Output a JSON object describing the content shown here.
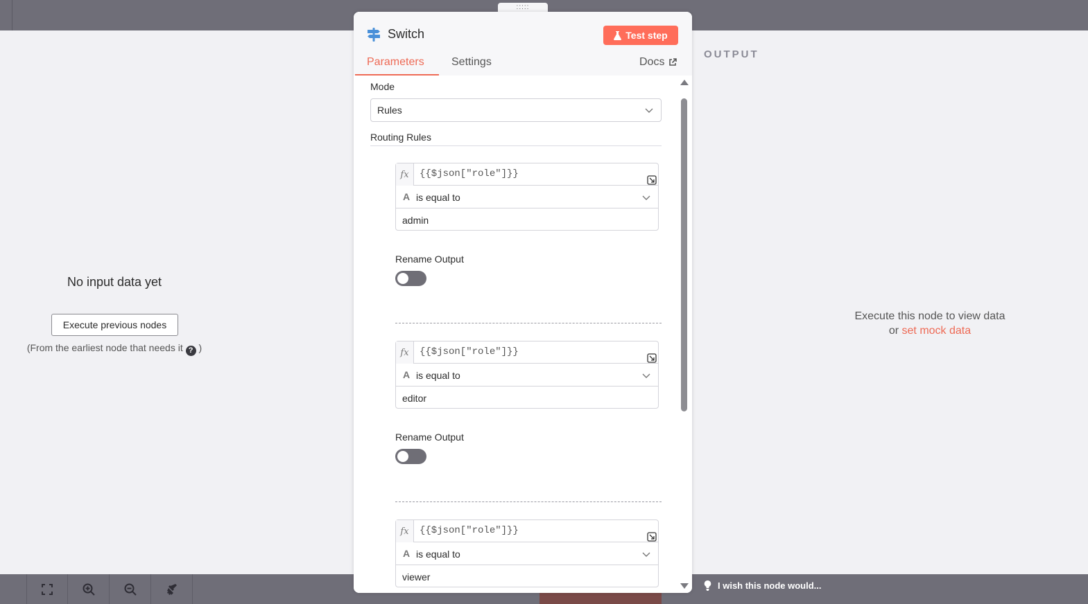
{
  "node": {
    "title": "Switch",
    "test_step_label": "Test step",
    "drag_handle": ":::::",
    "accent": "#ff6d5a",
    "tabs": [
      {
        "label": "Parameters"
      },
      {
        "label": "Settings"
      },
      {
        "label": "Docs"
      }
    ]
  },
  "params": {
    "mode_label": "Mode",
    "mode_value": "Rules",
    "routing_rules_label": "Routing Rules",
    "rules": [
      {
        "fx": "fx",
        "expression": "{{$json[\"role\"]}}",
        "type_glyph": "A",
        "operator": "is equal to",
        "value": "admin",
        "rename_label": "Rename Output",
        "rename_enabled": false
      },
      {
        "fx": "fx",
        "expression": "{{$json[\"role\"]}}",
        "type_glyph": "A",
        "operator": "is equal to",
        "value": "editor",
        "rename_label": "Rename Output",
        "rename_enabled": false
      },
      {
        "fx": "fx",
        "expression": "{{$json[\"role\"]}}",
        "type_glyph": "A",
        "operator": "is equal to",
        "value": "viewer"
      }
    ]
  },
  "input_panel": {
    "title": "No input data yet",
    "button_label": "Execute previous nodes",
    "hint_prefix": "(From the earliest node that needs it",
    "hint_suffix": ")",
    "help_glyph": "?"
  },
  "output_panel": {
    "label": "OUTPUT",
    "message_line1": "Execute this node to view data",
    "message_or": "or",
    "mock_link": "set mock data"
  },
  "footer": {
    "wish_text": "I wish this node would..."
  }
}
